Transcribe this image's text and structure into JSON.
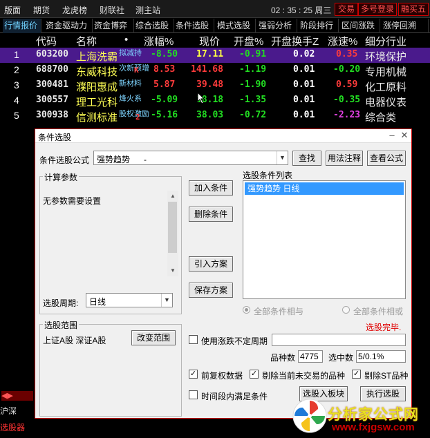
{
  "menu": [
    "版面",
    "期货",
    "龙虎榜",
    "财联社",
    "测主站"
  ],
  "clock": "02 : 35 : 25 周三",
  "top_buttons": [
    "交易",
    "多号登录",
    "融买五"
  ],
  "tabs": [
    "行情报价",
    "资金驱动力",
    "资金博弈",
    "综合选股",
    "条件选股",
    "模式选股",
    "强弱分析",
    "阶段排行",
    "区间涨跌",
    "涨停回溯"
  ],
  "columns": [
    "代码",
    "名称",
    "•",
    "涨幅%",
    "现价",
    "开盘%",
    "开盘换手Z",
    "涨速%",
    "细分行业"
  ],
  "rows": [
    {
      "idx": "1",
      "code": "603200",
      "name": "上海洗霸",
      "tag": "拟减持",
      "chg": "-8.50",
      "price": "17.11",
      "open": "-0.91",
      "turn": "0.02",
      "speed": "0.35",
      "ind": "环境保护"
    },
    {
      "idx": "2",
      "code": "688700",
      "name": "东威科技",
      "tag": "次新预增",
      "mark": "K",
      "chg": "8.53",
      "price": "141.68",
      "open": "-1.19",
      "turn": "0.01",
      "speed": "-0.20",
      "ind": "专用机械"
    },
    {
      "idx": "3",
      "code": "300481",
      "name": "濮阳惠成",
      "tag": "新材料",
      "chg": "5.87",
      "price": "39.48",
      "open": "-1.90",
      "turn": "0.01",
      "speed": "0.59",
      "ind": "化工原料"
    },
    {
      "idx": "4",
      "code": "300557",
      "name": "理工光科",
      "tag": "烽火系",
      "chg": "-5.09",
      "price": "18.18",
      "open": "-1.35",
      "turn": "0.01",
      "speed": "-0.35",
      "ind": "电器仪表"
    },
    {
      "idx": "5",
      "code": "300938",
      "name": "信测标准",
      "tag": "股权激励",
      "mark": "2",
      "chg": "-5.16",
      "price": "38.03",
      "open": "-0.72",
      "turn": "0.01",
      "speed": "-2.23",
      "ind": "综合类"
    }
  ],
  "bottom": {
    "b1": "选股器",
    "b2": "沪深",
    "b3": "选股器"
  },
  "dialog": {
    "title": "条件选股",
    "formula_label": "条件选股公式",
    "formula_value": "强势趋势      -",
    "find": "查找",
    "usage": "用法注释",
    "view": "查看公式",
    "calc_params": "计算参数",
    "no_params": "无参数需要设置",
    "add_cond": "加入条件",
    "del_cond": "删除条件",
    "import_plan": "引入方案",
    "save_plan": "保存方案",
    "cond_list_label": "选股条件列表",
    "cond_list": [
      "强势趋势  日线"
    ],
    "all_and": "全部条件相与",
    "all_or": "全部条件相或",
    "done": "选股完毕.",
    "period_label": "选股周期:",
    "period_value": "日线",
    "range_label": "选股范围",
    "range_value": "上证A股 深证A股",
    "change_range": "改变范围",
    "use_uncertain": "使用涨跌不定周期",
    "count_label": "品种数",
    "count_value": "4775",
    "selected_label": "选中数",
    "selected_value": "5/0.1%",
    "prev_adj": "前复权数据",
    "skip_suspended": "剔除当前未交易的品种",
    "skip_st": "剔除ST品种",
    "in_period": "时间段内满足条件",
    "to_block": "选股入板块",
    "run": "执行选股"
  },
  "watermark": {
    "t1": "分析家公式网",
    "t2": "www.fxjgsw.com"
  },
  "colors": {
    "accent": "#c00000",
    "selected_row": "#4a1a8c",
    "up": "#ff3b3b",
    "down": "#22dd22"
  }
}
